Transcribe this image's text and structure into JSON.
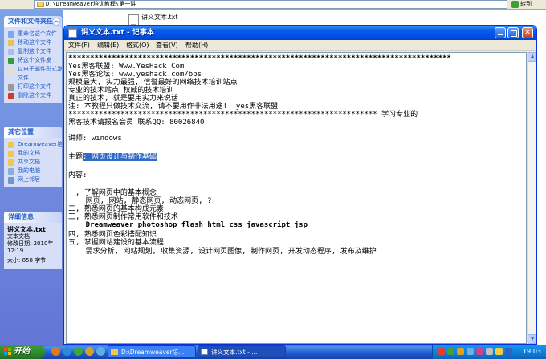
{
  "explorer": {
    "address": "D:\\Dreamweaver培训教程\\第一讲",
    "go_label": "转到",
    "file_label": "讲义文本.txt",
    "panels": {
      "tasks": {
        "title": "文件和文件夹任务",
        "items": [
          "重命名这个文件",
          "移动这个文件",
          "复制这个文件",
          "将这个文件发",
          "以电子邮件形式发送",
          "文件",
          "打印这个文件",
          "删除这个文件"
        ]
      },
      "places": {
        "title": "其它位置",
        "items": [
          "Dreamweaver培训",
          "我的文档",
          "共享文档",
          "我的电脑",
          "网上邻居"
        ]
      },
      "details": {
        "title": "详细信息",
        "name": "讲义文本.txt",
        "type": "文本文档",
        "modified": "修改日期: 2010年",
        "time": "12:19",
        "size": "大小: 858 字节"
      }
    }
  },
  "notepad": {
    "title": "讲义文本.txt - 记事本",
    "menus": [
      "文件(F)",
      "编辑(E)",
      "格式(O)",
      "查看(V)",
      "帮助(H)"
    ],
    "lines": [
      "****************************************************************************************",
      "Yes黑客联盟: Www.YesHack.Com",
      "Yes黑客论坛: www.yeshack.com/bbs",
      "规模最大, 实力最强, 信誉最好的网络技术培训站点",
      "专业的技术站点 权威的技术培训",
      "真正的技术, 就是要用实力来说话",
      "注: 本教程只做技术交流, 请不要用作非法用途!  yes黑客联盟",
      "*********************************************************************** 学习专业的",
      "黑客技术请报名会员 联系QQ: 80026840",
      "",
      "讲师: windows",
      "",
      "",
      "",
      "内容:",
      "",
      "一, 了解网页中的基本概念",
      "    网页, 网站, 静态网页, 动态网页, ?",
      "二, 熟悉网页的基本构成元素",
      "三, 熟悉网页制作常用软件和技术",
      "    Dreamweaver photoshop flash html css javascript jsp",
      "四, 熟悉网页色彩搭配知识",
      "五, 掌握网站建设的基本流程",
      "    需求分析, 网站规划, 收集资源, 设计网页图像, 制作网页, 开发动态程序, 发布及维护"
    ],
    "topic_prefix": "主题",
    "topic_selected": ": 网页设计与制作基础"
  },
  "taskbar": {
    "start_label": "开始",
    "tasks": [
      "D:\\Dreamweaver培...",
      "讲义文本.txt - ..."
    ],
    "clock": "19:03"
  },
  "colors": {
    "titlebar": "#0050ea",
    "selection": "#316ac5",
    "taskbar": "#2157d7",
    "start": "#3c9e3c",
    "sidebar": "#6f8fe0"
  }
}
